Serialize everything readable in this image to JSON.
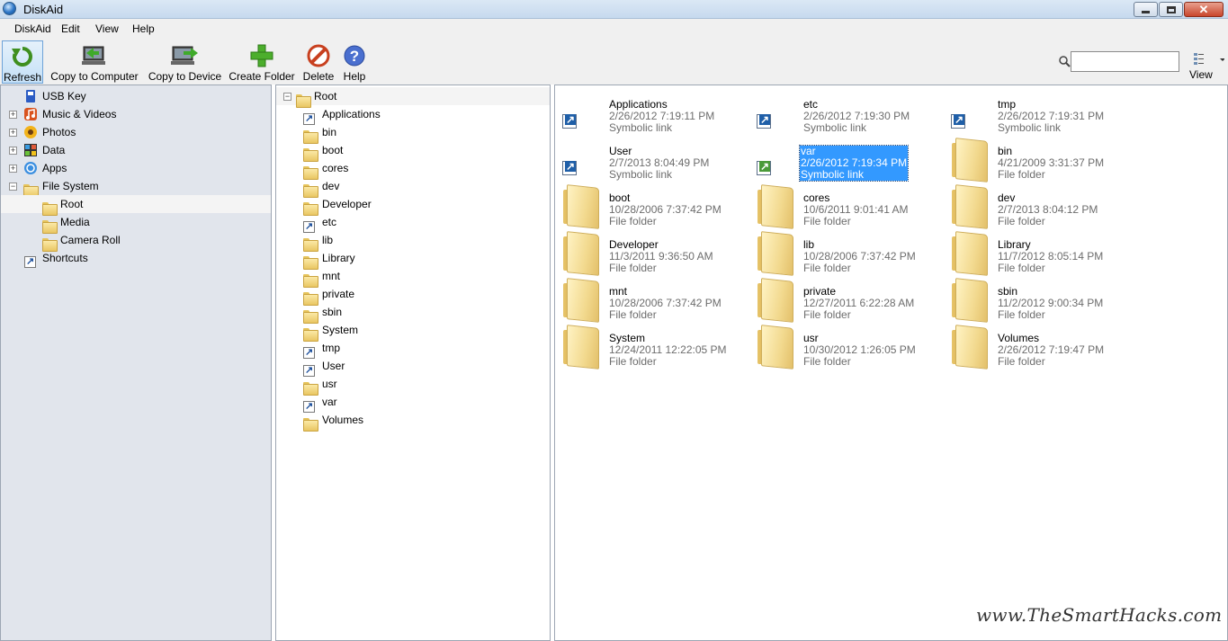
{
  "window": {
    "title": "DiskAid"
  },
  "menu": [
    "DiskAid",
    "Edit",
    "View",
    "Help"
  ],
  "toolbar": {
    "refresh": "Refresh",
    "copy_to_computer": "Copy to Computer",
    "copy_to_device": "Copy to Device",
    "create_folder": "Create Folder",
    "delete": "Delete",
    "help": "Help",
    "view": "View",
    "search_value": ""
  },
  "sidebar": [
    {
      "label": "USB Key",
      "icon": "usb-key-icon",
      "expandable": false
    },
    {
      "label": "Music & Videos",
      "icon": "music-icon",
      "expandable": true
    },
    {
      "label": "Photos",
      "icon": "photos-icon",
      "expandable": true
    },
    {
      "label": "Data",
      "icon": "data-icon",
      "expandable": true
    },
    {
      "label": "Apps",
      "icon": "apps-icon",
      "expandable": true
    },
    {
      "label": "File System",
      "icon": "folder-icon",
      "expandable": true,
      "expanded": true
    },
    {
      "label": "Root",
      "icon": "folder-icon",
      "selected": true
    },
    {
      "label": "Media",
      "icon": "folder-icon"
    },
    {
      "label": "Camera Roll",
      "icon": "folder-icon"
    },
    {
      "label": "Shortcuts",
      "icon": "shortcut-icon"
    }
  ],
  "tree": {
    "root": "Root",
    "children": [
      {
        "label": "Applications",
        "type": "link"
      },
      {
        "label": "bin",
        "type": "folder"
      },
      {
        "label": "boot",
        "type": "folder"
      },
      {
        "label": "cores",
        "type": "folder"
      },
      {
        "label": "dev",
        "type": "folder"
      },
      {
        "label": "Developer",
        "type": "folder"
      },
      {
        "label": "etc",
        "type": "link"
      },
      {
        "label": "lib",
        "type": "folder"
      },
      {
        "label": "Library",
        "type": "folder"
      },
      {
        "label": "mnt",
        "type": "folder"
      },
      {
        "label": "private",
        "type": "folder"
      },
      {
        "label": "sbin",
        "type": "folder"
      },
      {
        "label": "System",
        "type": "folder"
      },
      {
        "label": "tmp",
        "type": "link"
      },
      {
        "label": "User",
        "type": "link"
      },
      {
        "label": "usr",
        "type": "folder"
      },
      {
        "label": "var",
        "type": "link"
      },
      {
        "label": "Volumes",
        "type": "folder"
      }
    ]
  },
  "items": [
    {
      "name": "Applications",
      "date": "2/26/2012 7:19:11 PM",
      "type": "Symbolic link"
    },
    {
      "name": "etc",
      "date": "2/26/2012 7:19:30 PM",
      "type": "Symbolic link"
    },
    {
      "name": "tmp",
      "date": "2/26/2012 7:19:31 PM",
      "type": "Symbolic link"
    },
    {
      "name": "User",
      "date": "2/7/2013 8:04:49 PM",
      "type": "Symbolic link"
    },
    {
      "name": "var",
      "date": "2/26/2012 7:19:34 PM",
      "type": "Symbolic link",
      "selected": true
    },
    {
      "name": "bin",
      "date": "4/21/2009 3:31:37 PM",
      "type": "File folder"
    },
    {
      "name": "boot",
      "date": "10/28/2006 7:37:42 PM",
      "type": "File folder"
    },
    {
      "name": "cores",
      "date": "10/6/2011 9:01:41 AM",
      "type": "File folder"
    },
    {
      "name": "dev",
      "date": "2/7/2013 8:04:12 PM",
      "type": "File folder"
    },
    {
      "name": "Developer",
      "date": "11/3/2011 9:36:50 AM",
      "type": "File folder"
    },
    {
      "name": "lib",
      "date": "10/28/2006 7:37:42 PM",
      "type": "File folder"
    },
    {
      "name": "Library",
      "date": "11/7/2012 8:05:14 PM",
      "type": "File folder"
    },
    {
      "name": "mnt",
      "date": "10/28/2006 7:37:42 PM",
      "type": "File folder"
    },
    {
      "name": "private",
      "date": "12/27/2011 6:22:28 AM",
      "type": "File folder"
    },
    {
      "name": "sbin",
      "date": "11/2/2012 9:00:34 PM",
      "type": "File folder"
    },
    {
      "name": "System",
      "date": "12/24/2011 12:22:05 PM",
      "type": "File folder"
    },
    {
      "name": "usr",
      "date": "10/30/2012 1:26:05 PM",
      "type": "File folder"
    },
    {
      "name": "Volumes",
      "date": "2/26/2012 7:19:47 PM",
      "type": "File folder"
    }
  ],
  "watermark": "www.TheSmartHacks.com",
  "colors": {
    "selection": "#3399ff",
    "titlebar": "#c6d9ee",
    "sidebar_bg": "#e1e5ec"
  }
}
